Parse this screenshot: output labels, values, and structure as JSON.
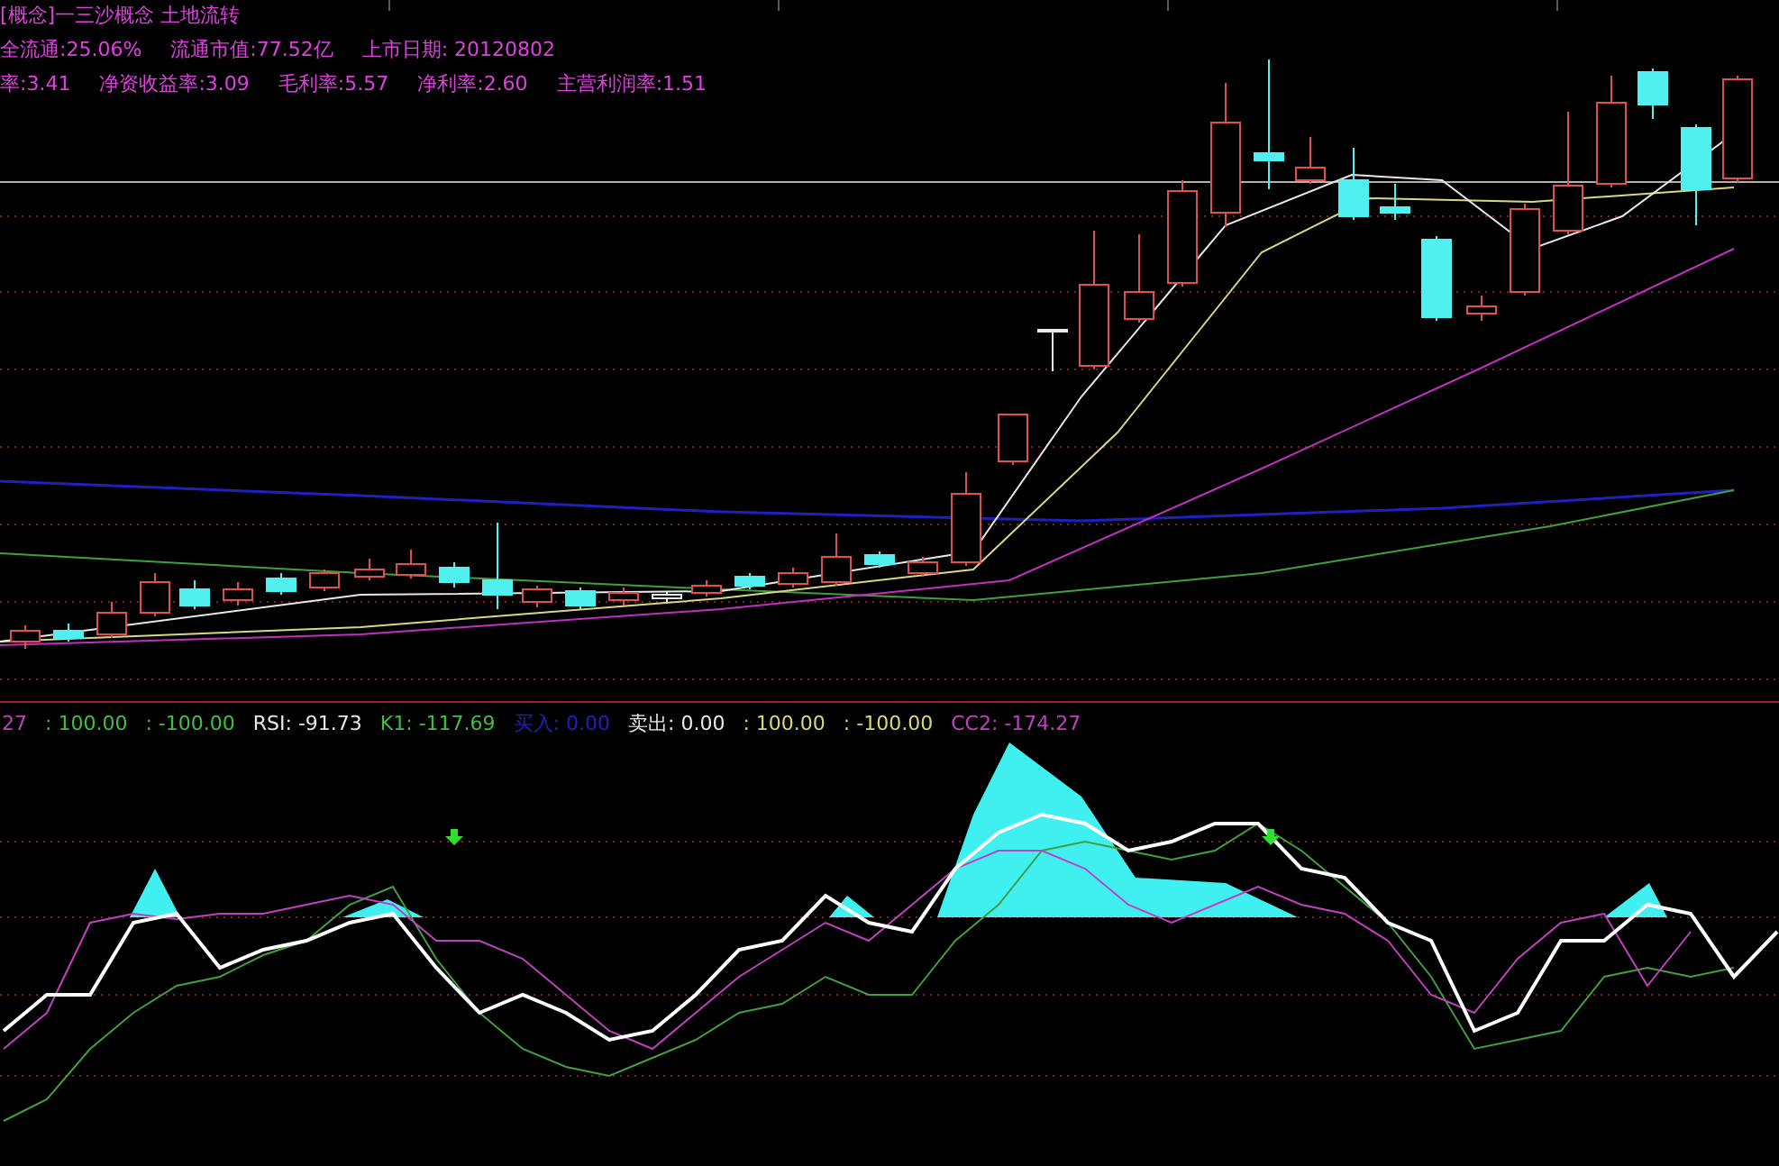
{
  "header": {
    "concepts": "[概念]一三沙概念 土地流转",
    "row_1": [
      {
        "label": "全流通:25.06%"
      },
      {
        "label": "流通市值:77.52亿"
      },
      {
        "label": "上市日期: 20120802"
      }
    ],
    "row_2": [
      {
        "label": "率:3.41"
      },
      {
        "label": "净资收益率:3.09"
      },
      {
        "label": "毛利率:5.57"
      },
      {
        "label": "净利率:2.60"
      },
      {
        "label": "主营利润率:1.51"
      }
    ]
  },
  "indicator_legend": [
    {
      "text": "27",
      "color": "#c040c0"
    },
    {
      "text": ": 100.00",
      "color": "#40c040"
    },
    {
      "text": ": -100.00",
      "color": "#40c040"
    },
    {
      "text": "RSI: -91.73",
      "color": "#e8e8e8"
    },
    {
      "text": "K1: -117.69",
      "color": "#40c040"
    },
    {
      "text": "买入: 0.00",
      "color": "#2020c0"
    },
    {
      "text": "卖出: 0.00",
      "color": "#e8e8e8"
    },
    {
      "text": ": 100.00",
      "color": "#d8d870"
    },
    {
      "text": ": -100.00",
      "color": "#d8d870"
    },
    {
      "text": "CC2: -174.27",
      "color": "#c040c0"
    }
  ]
}
